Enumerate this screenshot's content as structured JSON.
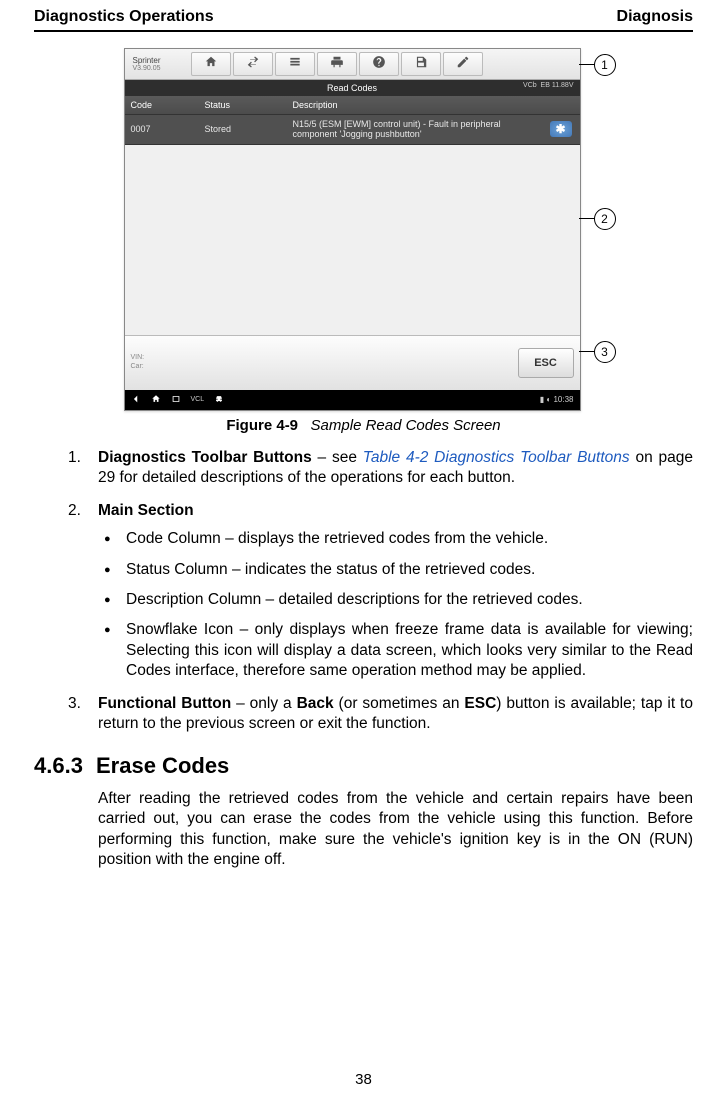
{
  "header": {
    "left": "Diagnostics Operations",
    "right": "Diagnosis"
  },
  "figure": {
    "app_name": "Sprinter",
    "app_version": "V3.90.05",
    "title_bar": "Read Codes",
    "vci_label": "VCb",
    "voltage": "EB 11.88V",
    "columns": {
      "code": "Code",
      "status": "Status",
      "description": "Description"
    },
    "row": {
      "code": "0007",
      "status": "Stored",
      "description": "N15/5 (ESM [EWM] control unit) - Fault in peripheral component 'Jogging pushbutton'"
    },
    "vin_label": "VIN:",
    "car_label": "Car:",
    "esc_label": "ESC",
    "clock": "10:38",
    "caption_no": "Figure 4-9",
    "caption_title": "Sample Read Codes Screen",
    "callouts": {
      "one": "1",
      "two": "2",
      "three": "3"
    }
  },
  "list": {
    "item1_a": "Diagnostics Toolbar Buttons",
    "item1_b": " – see ",
    "item1_link": "Table 4-2 Diagnostics Toolbar Buttons",
    "item1_c": " on page 29 for detailed descriptions of the operations for each button.",
    "item2_title": "Main Section",
    "b1": "Code Column – displays the retrieved codes from the vehicle.",
    "b2": "Status Column – indicates the status of the retrieved codes.",
    "b3": "Description Column – detailed descriptions for the retrieved codes.",
    "b4": "Snowflake Icon – only displays when freeze frame data is available for viewing; Selecting this icon will display a data screen, which looks very similar to the Read Codes interface, therefore same operation method may be applied.",
    "item3_a": "Functional Button",
    "item3_b": " – only a ",
    "item3_c": "Back",
    "item3_d": " (or sometimes an ",
    "item3_e": "ESC",
    "item3_f": ") button is available; tap it to return to the previous screen or exit the function."
  },
  "section": {
    "num": "4.6.3",
    "title": "Erase Codes",
    "para": "After reading the retrieved codes from the vehicle and certain repairs have been carried out, you can erase the codes from the vehicle using this function. Before performing this function, make sure the vehicle's ignition key is in the ON (RUN) position with the engine off."
  },
  "page_number": "38"
}
